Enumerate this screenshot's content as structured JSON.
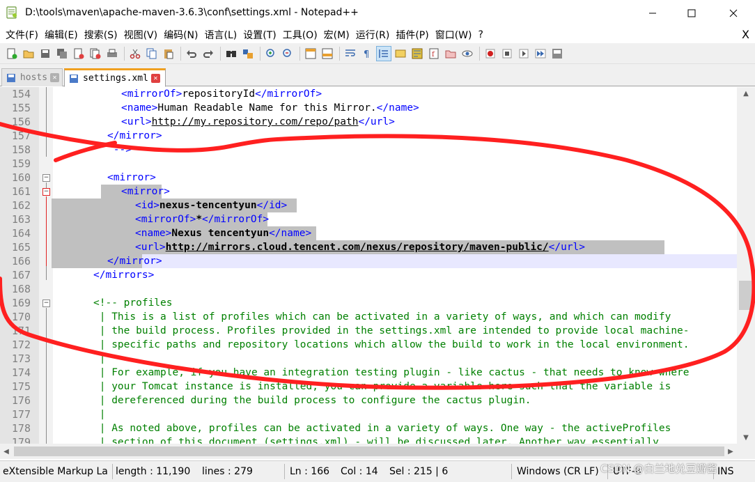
{
  "window": {
    "title": "D:\\tools\\maven\\apache-maven-3.6.3\\conf\\settings.xml - Notepad++",
    "minimize": "—",
    "maximize": "☐",
    "close": "✕"
  },
  "menu": {
    "items": [
      "文件(F)",
      "编辑(E)",
      "搜索(S)",
      "视图(V)",
      "编码(N)",
      "语言(L)",
      "设置(T)",
      "工具(O)",
      "宏(M)",
      "运行(R)",
      "插件(P)",
      "窗口(W)",
      "?"
    ],
    "close_doc": "X"
  },
  "tabs": [
    {
      "label": "hosts",
      "active": false
    },
    {
      "label": "settings.xml",
      "active": true
    }
  ],
  "editor": {
    "lines": [
      {
        "n": "154",
        "indent": 8,
        "parts": [
          [
            "tag",
            "<mirrorOf>"
          ],
          [
            "txt",
            "repositoryId"
          ],
          [
            "tag",
            "</mirrorOf>"
          ]
        ]
      },
      {
        "n": "155",
        "indent": 8,
        "parts": [
          [
            "tag",
            "<name>"
          ],
          [
            "txt",
            "Human Readable Name for this Mirror."
          ],
          [
            "tag",
            "</name>"
          ]
        ]
      },
      {
        "n": "156",
        "indent": 8,
        "parts": [
          [
            "tag",
            "<url>"
          ],
          [
            "url",
            "http://my.repository.com/repo/path"
          ],
          [
            "tag",
            "</url>"
          ]
        ]
      },
      {
        "n": "157",
        "indent": 6,
        "parts": [
          [
            "tag",
            "</mirror>"
          ]
        ]
      },
      {
        "n": "158",
        "indent": 6,
        "parts": [
          [
            "tag",
            " -->"
          ]
        ]
      },
      {
        "n": "159",
        "indent": 0,
        "parts": []
      },
      {
        "n": "160",
        "indent": 6,
        "parts": [
          [
            "tag",
            "<mirror>"
          ]
        ]
      },
      {
        "n": "161",
        "indent": 8,
        "parts": [
          [
            "tag",
            "<mirror>"
          ]
        ]
      },
      {
        "n": "162",
        "indent": 10,
        "parts": [
          [
            "tag",
            "<id>"
          ],
          [
            "bold",
            "nexus-tencentyun"
          ],
          [
            "tag",
            "</id>"
          ]
        ]
      },
      {
        "n": "163",
        "indent": 10,
        "parts": [
          [
            "tag",
            "<mirrorOf>"
          ],
          [
            "bold",
            "*"
          ],
          [
            "tag",
            "</mirrorOf>"
          ]
        ]
      },
      {
        "n": "164",
        "indent": 10,
        "parts": [
          [
            "tag",
            "<name>"
          ],
          [
            "bold",
            "Nexus tencentyun"
          ],
          [
            "tag",
            "</name>"
          ]
        ]
      },
      {
        "n": "165",
        "indent": 10,
        "parts": [
          [
            "tag",
            "<url>"
          ],
          [
            "boldurl",
            "http://mirrors.cloud.tencent.com/nexus/repository/maven-public/"
          ],
          [
            "tag",
            "</url>"
          ]
        ]
      },
      {
        "n": "166",
        "indent": 6,
        "parts": [
          [
            "tag",
            "</mirror>"
          ]
        ]
      },
      {
        "n": "167",
        "indent": 4,
        "parts": [
          [
            "tag",
            "</mirrors>"
          ]
        ]
      },
      {
        "n": "168",
        "indent": 0,
        "parts": []
      },
      {
        "n": "169",
        "indent": 4,
        "parts": [
          [
            "comment",
            "<!-- profiles"
          ]
        ]
      },
      {
        "n": "170",
        "indent": 4,
        "parts": [
          [
            "comment",
            " | This is a list of profiles which can be activated in a variety of ways, and which can modify"
          ]
        ]
      },
      {
        "n": "171",
        "indent": 4,
        "parts": [
          [
            "comment",
            " | the build process. Profiles provided in the settings.xml are intended to provide local machine-"
          ]
        ]
      },
      {
        "n": "172",
        "indent": 4,
        "parts": [
          [
            "comment",
            " | specific paths and repository locations which allow the build to work in the local environment."
          ]
        ]
      },
      {
        "n": "173",
        "indent": 4,
        "parts": [
          [
            "comment",
            " |"
          ]
        ]
      },
      {
        "n": "174",
        "indent": 4,
        "parts": [
          [
            "comment",
            " | For example, if you have an integration testing plugin - like cactus - that needs to know where"
          ]
        ]
      },
      {
        "n": "175",
        "indent": 4,
        "parts": [
          [
            "comment",
            " | your Tomcat instance is installed, you can provide a variable here such that the variable is"
          ]
        ]
      },
      {
        "n": "176",
        "indent": 4,
        "parts": [
          [
            "comment",
            " | dereferenced during the build process to configure the cactus plugin."
          ]
        ]
      },
      {
        "n": "177",
        "indent": 4,
        "parts": [
          [
            "comment",
            " |"
          ]
        ]
      },
      {
        "n": "178",
        "indent": 4,
        "parts": [
          [
            "comment",
            " | As noted above, profiles can be activated in a variety of ways. One way - the activeProfiles"
          ]
        ]
      },
      {
        "n": "179",
        "indent": 4,
        "parts": [
          [
            "comment",
            " | section of this document (settings.xml) - will be discussed later. Another way essentially"
          ]
        ]
      }
    ]
  },
  "status": {
    "language": "eXtensible Markup La",
    "length": "length : 11,190",
    "lines": "lines : 279",
    "ln": "Ln : 166",
    "col": "Col : 14",
    "sel": "Sel : 215 | 6",
    "eol": "Windows (CR LF)",
    "encoding": "UTF-8",
    "mode": "INS"
  },
  "watermark": "CSDN @白兰地兑豆瓣酱",
  "colors": {
    "annotation": "#ff2020",
    "tag": "#0000ff",
    "comment": "#008000",
    "selection": "#c0c0c0",
    "active_tab_accent": "#f0a020"
  }
}
